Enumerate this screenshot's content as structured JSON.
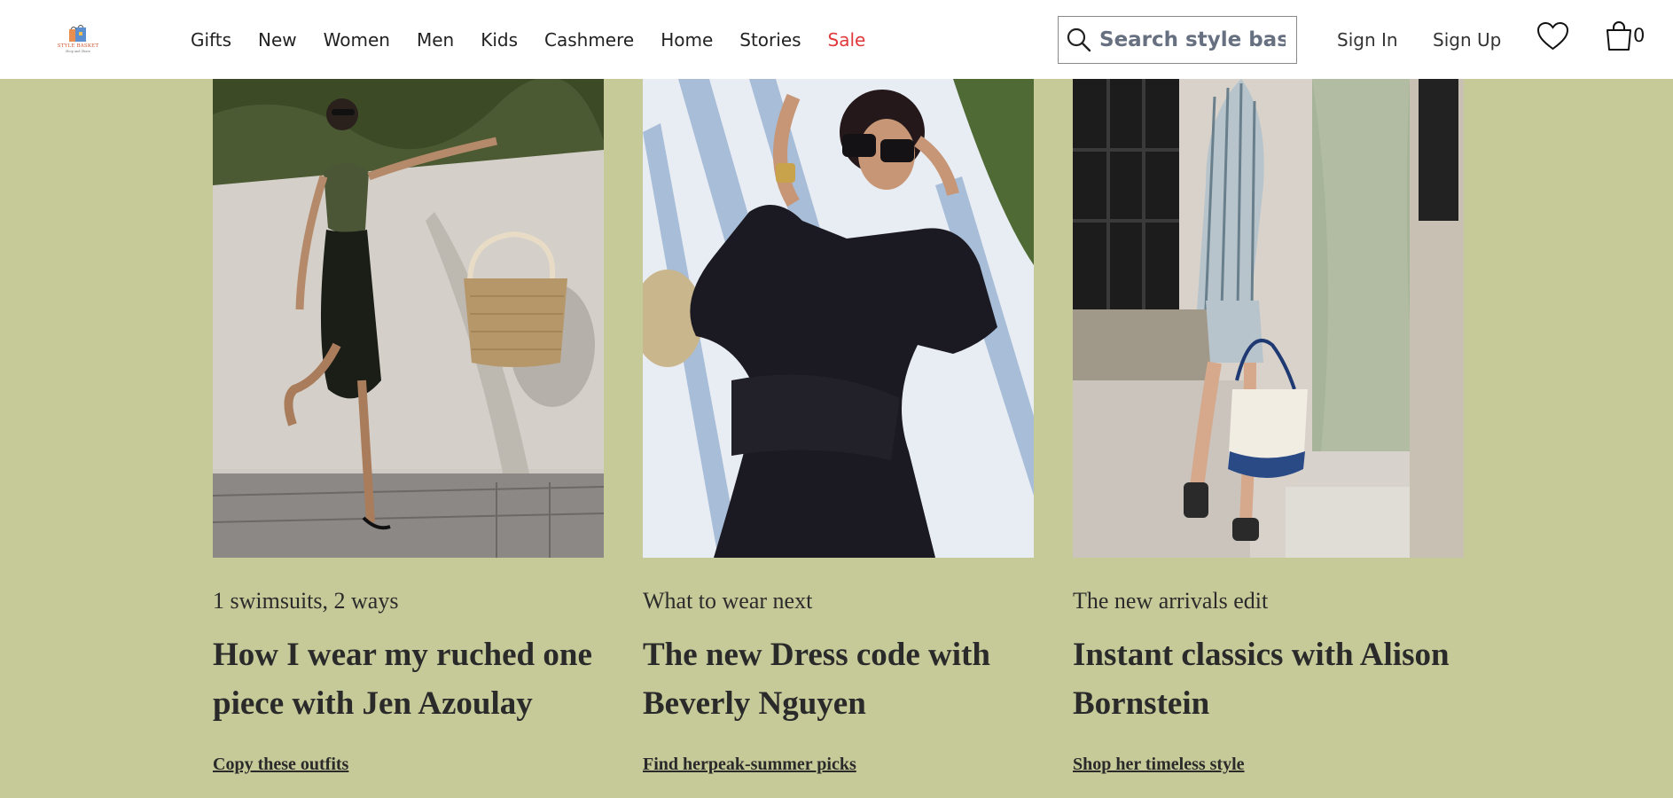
{
  "brand": {
    "logo_text": "STYLE BASKET",
    "logo_tagline": "Shop and Share"
  },
  "nav": {
    "items": [
      {
        "label": "Gifts"
      },
      {
        "label": "New"
      },
      {
        "label": "Women"
      },
      {
        "label": "Men"
      },
      {
        "label": "Kids"
      },
      {
        "label": "Cashmere"
      },
      {
        "label": "Home"
      },
      {
        "label": "Stories"
      },
      {
        "label": "Sale"
      }
    ]
  },
  "search": {
    "placeholder": "Search style basket",
    "icon": "search-icon"
  },
  "account": {
    "sign_in": "Sign In",
    "sign_up": "Sign Up",
    "wishlist_icon": "heart-icon",
    "cart_icon": "shopping-bag-icon",
    "cart_count": "0"
  },
  "colors": {
    "page_background": "#c5ca98",
    "sale": "#e0383b"
  },
  "stories": [
    {
      "eyebrow": "1 swimsuits, 2 ways",
      "headline": "How I wear my ruched one piece with Jen Azoulay",
      "cta": "Copy these outfits"
    },
    {
      "eyebrow": "What to wear next",
      "headline": "The new Dress code with Beverly Nguyen",
      "cta": "Find herpeak-summer picks"
    },
    {
      "eyebrow": "The new arrivals edit",
      "headline": "Instant classics with Alison Bornstein",
      "cta": "Shop her timeless style"
    }
  ]
}
